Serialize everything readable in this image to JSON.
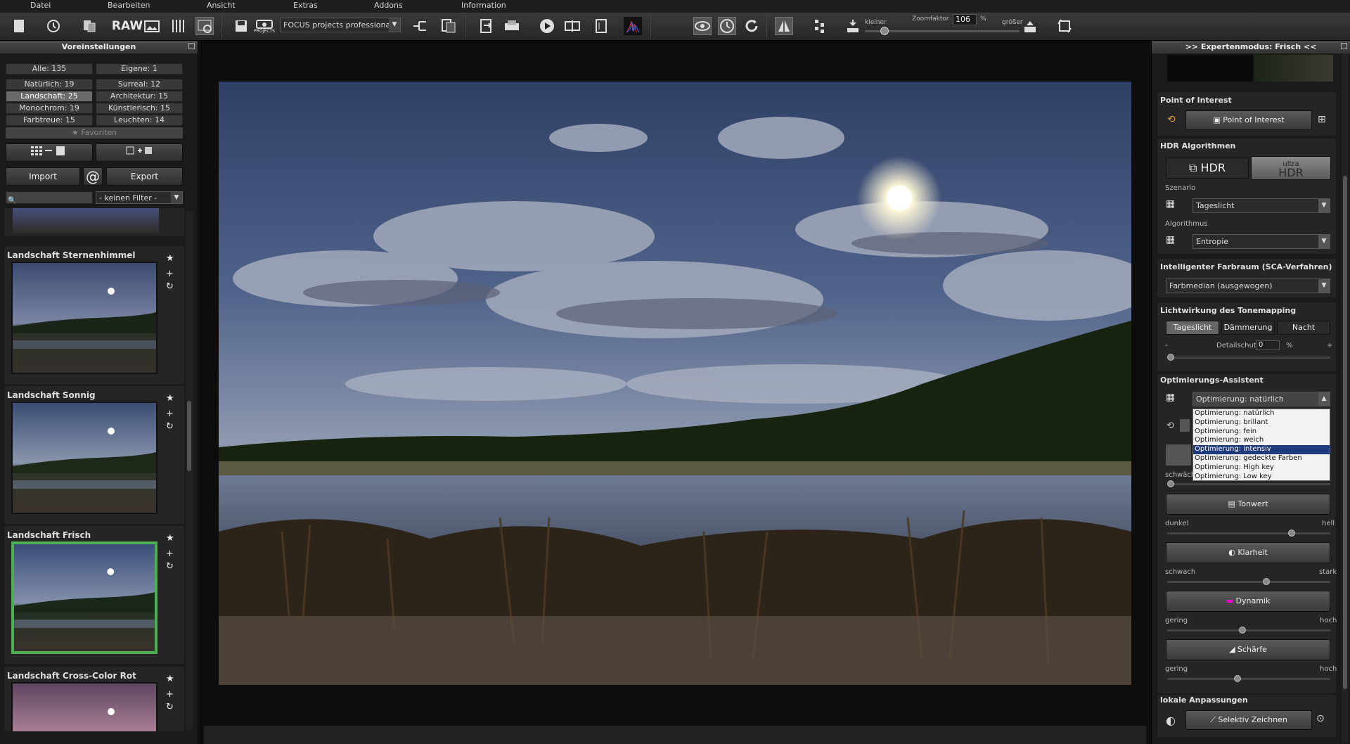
{
  "menu": [
    "Datei",
    "Bearbeiten",
    "Ansicht",
    "Extras",
    "Addons",
    "Information"
  ],
  "toolbar": {
    "raw_label": "RAW",
    "projects_label": "PROJECTS",
    "preset_select": "FOCUS projects professional",
    "zoom_smaller": "kleiner",
    "zoom_label": "Zoomfaktor",
    "zoom_value": "106",
    "zoom_unit": "%",
    "zoom_larger": "größer"
  },
  "left": {
    "title": "Voreinstellungen",
    "categories": [
      {
        "label": "Alle: 135",
        "active": false
      },
      {
        "label": "Eigene: 1",
        "active": false
      },
      {
        "label": "Natürlich: 19",
        "active": false
      },
      {
        "label": "Surreal: 12",
        "active": false
      },
      {
        "label": "Landschaft: 25",
        "active": true
      },
      {
        "label": "Architektur: 15",
        "active": false
      },
      {
        "label": "Monochrom: 19",
        "active": false
      },
      {
        "label": "Künstlerisch: 15",
        "active": false
      },
      {
        "label": "Farbtreue: 15",
        "active": false
      },
      {
        "label": "Leuchten: 14",
        "active": false
      }
    ],
    "favorites": "Favoriten",
    "import": "Import",
    "export": "Export",
    "at": "@",
    "filter": "- keinen Filter -",
    "presets": [
      {
        "name": "Landschaft Sternenhimmel"
      },
      {
        "name": "Landschaft Sonnig"
      },
      {
        "name": "Landschaft Frisch"
      },
      {
        "name": "Landschaft Cross-Color Rot"
      }
    ]
  },
  "right": {
    "title": ">> Expertenmodus: Frisch <<",
    "poi_title": "Point of Interest",
    "poi_button": "Point of Interest",
    "hdr_title": "HDR Algorithmen",
    "hdr_btn": "HDR",
    "ultra_top": "ultra",
    "ultra_bottom": "HDR",
    "szenario_label": "Szenario",
    "szenario_value": "Tageslicht",
    "algorithmus_label": "Algorithmus",
    "algorithmus_value": "Entropie",
    "sca_title": "Intelligenter Farbraum (SCA-Verfahren)",
    "sca_value": "Farbmedian (ausgewogen)",
    "licht_title": "Lichtwirkung des Tonemapping",
    "licht_tabs": [
      "Tageslicht",
      "Dämmerung",
      "Nacht"
    ],
    "detail_label": "Detailschutz",
    "detail_value": "0",
    "detail_unit": "%",
    "minus": "-",
    "plus": "+",
    "opt_title": "Optimierungs-Assistent",
    "opt_value": "Optimierung: natürlich",
    "opt_options": [
      "Optimierung: natürlich",
      "Optimierung: brillant",
      "Optimierung: fein",
      "Optimierung: weich",
      "Optimierung: intensiv",
      "Optimierung: gedeckte Farben",
      "Optimierung: High key",
      "Optimierung: Low key"
    ],
    "opt_selected": 4,
    "schwaecher": "schwäch",
    "tonwert": "Tonwert",
    "dunkel": "dunkel",
    "hell": "hell",
    "klarheit": "Klarheit",
    "schwach": "schwach",
    "stark": "stark",
    "dynamik": "Dynamik",
    "gering": "gering",
    "hoch": "hoch",
    "schaerfe": "Schärfe",
    "gering2": "gering",
    "hoch2": "hoch",
    "lokal_title": "lokale Anpassungen",
    "selektiv": "Selektiv Zeichnen"
  }
}
